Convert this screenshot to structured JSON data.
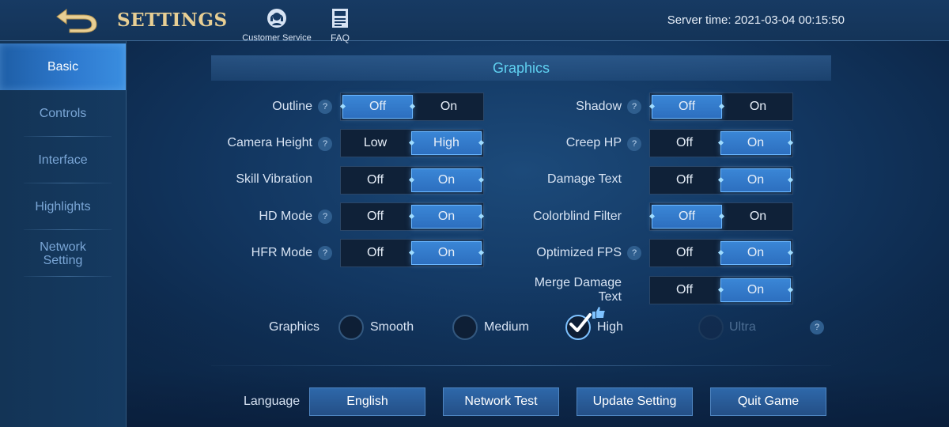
{
  "header": {
    "title": "SETTINGS",
    "customer_service": "Customer Service",
    "faq": "FAQ",
    "server_time": "Server time: 2021-03-04 00:15:50"
  },
  "sidebar": {
    "items": [
      {
        "label": "Basic",
        "active": true
      },
      {
        "label": "Controls"
      },
      {
        "label": "Interface"
      },
      {
        "label": "Highlights"
      },
      {
        "label": "Network Setting"
      }
    ]
  },
  "section": {
    "title": "Graphics"
  },
  "settings_left": [
    {
      "label": "Outline",
      "help": true,
      "options": [
        "Off",
        "On"
      ],
      "selected": "Off"
    },
    {
      "label": "Camera Height",
      "help": true,
      "options": [
        "Low",
        "High"
      ],
      "selected": "High"
    },
    {
      "label": "Skill Vibration",
      "help": false,
      "options": [
        "Off",
        "On"
      ],
      "selected": "On"
    },
    {
      "label": "HD Mode",
      "help": true,
      "options": [
        "Off",
        "On"
      ],
      "selected": "On"
    },
    {
      "label": "HFR Mode",
      "help": true,
      "options": [
        "Off",
        "On"
      ],
      "selected": "On"
    }
  ],
  "settings_right": [
    {
      "label": "Shadow",
      "help": true,
      "options": [
        "Off",
        "On"
      ],
      "selected": "Off"
    },
    {
      "label": "Creep HP",
      "help": true,
      "options": [
        "Off",
        "On"
      ],
      "selected": "On"
    },
    {
      "label": "Damage Text",
      "help": false,
      "options": [
        "Off",
        "On"
      ],
      "selected": "On"
    },
    {
      "label": "Colorblind Filter",
      "help": false,
      "options": [
        "Off",
        "On"
      ],
      "selected": "Off"
    },
    {
      "label": "Optimized FPS",
      "help": true,
      "options": [
        "Off",
        "On"
      ],
      "selected": "On"
    },
    {
      "label": "Merge Damage Text",
      "help": false,
      "options": [
        "Off",
        "On"
      ],
      "selected": "On"
    }
  ],
  "quality": {
    "label": "Graphics",
    "options": [
      "Smooth",
      "Medium",
      "High",
      "Ultra"
    ],
    "selected": "High",
    "disabled": "Ultra"
  },
  "help_glyph": "?",
  "footer": {
    "language_label": "Language",
    "language_value": "English",
    "network_test": "Network Test",
    "update_setting": "Update Setting",
    "quit_game": "Quit Game"
  },
  "colors": {
    "accent": "#3a86d6",
    "gold_title": "#e8cf94",
    "section_title": "#5fd0f0"
  }
}
